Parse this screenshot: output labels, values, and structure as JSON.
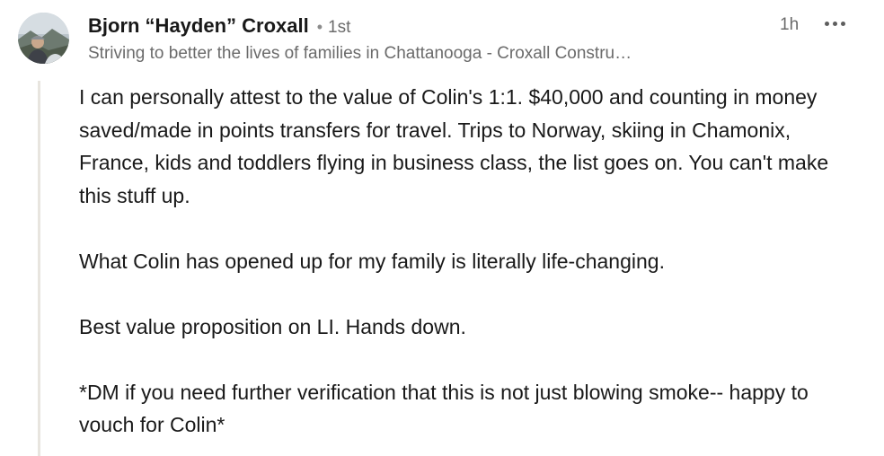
{
  "comment": {
    "author": {
      "name": "Bjorn “Hayden” Croxall",
      "separator": "•",
      "degree": "1st",
      "headline": "Striving to better the lives of families in Chattanooga - Croxall Constru…",
      "avatar": "profile-photo"
    },
    "timestamp": "1h",
    "more_icon": "ellipsis-icon",
    "paragraphs": [
      "I can personally attest to the value of Colin's 1:1. $40,000 and counting in money saved/made in points transfers for travel. Trips to Norway, skiing in Chamonix, France, kids and toddlers flying in business class, the list goes on. You can't make this stuff up.",
      "What Colin has opened up for my family is literally life-changing.",
      "Best value proposition on LI. Hands down.",
      "*DM if you need further verification that this is not just blowing smoke-- happy to vouch for Colin*"
    ]
  },
  "colors": {
    "text_primary": "#191919",
    "text_secondary": "#6b6b6b",
    "thread_line": "#e8e5df"
  }
}
